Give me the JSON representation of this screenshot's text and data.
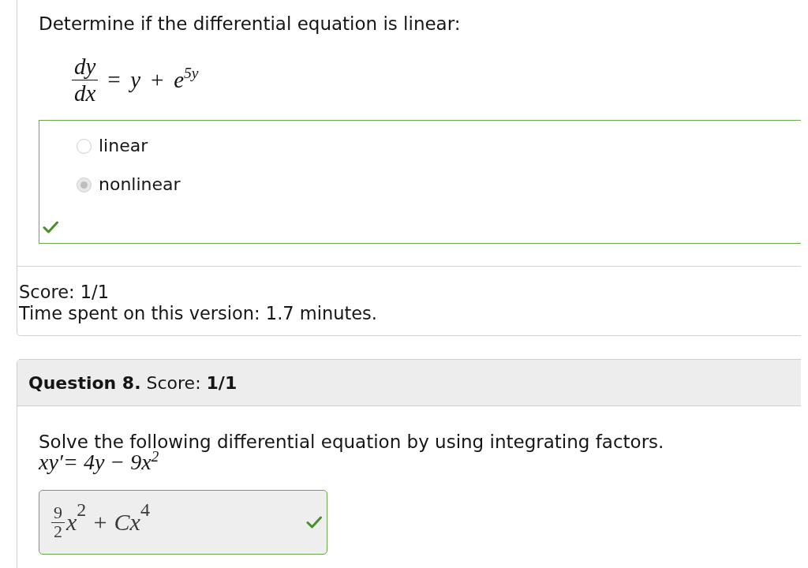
{
  "question_7": {
    "prompt": "Determine if the differential equation is linear:",
    "equation": {
      "numerator": "dy",
      "denominator": "dx",
      "rhs": "= y + e$^{5y}$"
    },
    "answer": {
      "correct": true,
      "choices": [
        {
          "label": "linear",
          "selected": false
        },
        {
          "label": "nonlinear",
          "selected": true
        }
      ]
    },
    "score": "Score: 1/1",
    "time_spent": "Time spent on this version: 1.7 minutes."
  },
  "question_8": {
    "header": "**Question 8.** Score: **1/1**",
    "prompt": "Solve the following differential equation by using integrating factors.",
    "equation": "xy′= 4y − 9x$^{2}$",
    "answer": {
      "correct": true,
      "numerator": "9",
      "denominator": "2",
      "expression": "x$^{2}$ + Cx$^{4}$"
    }
  }
}
